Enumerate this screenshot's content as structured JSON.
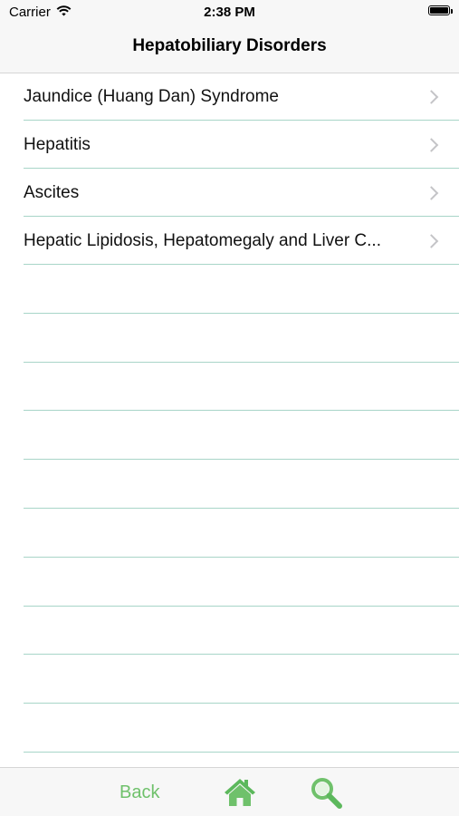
{
  "status_bar": {
    "carrier": "Carrier",
    "time": "2:38 PM"
  },
  "nav": {
    "title": "Hepatobiliary Disorders"
  },
  "list": {
    "items": [
      {
        "label": "Jaundice (Huang Dan) Syndrome"
      },
      {
        "label": "Hepatitis"
      },
      {
        "label": "Ascites"
      },
      {
        "label": "Hepatic Lipidosis, Hepatomegaly and Liver C..."
      }
    ]
  },
  "toolbar": {
    "back_label": "Back",
    "home_icon": "home-icon",
    "search_icon": "search-icon"
  },
  "colors": {
    "accent": "#6fc16b",
    "separator": "#a8d5c8",
    "bar_background": "#f7f7f7"
  }
}
